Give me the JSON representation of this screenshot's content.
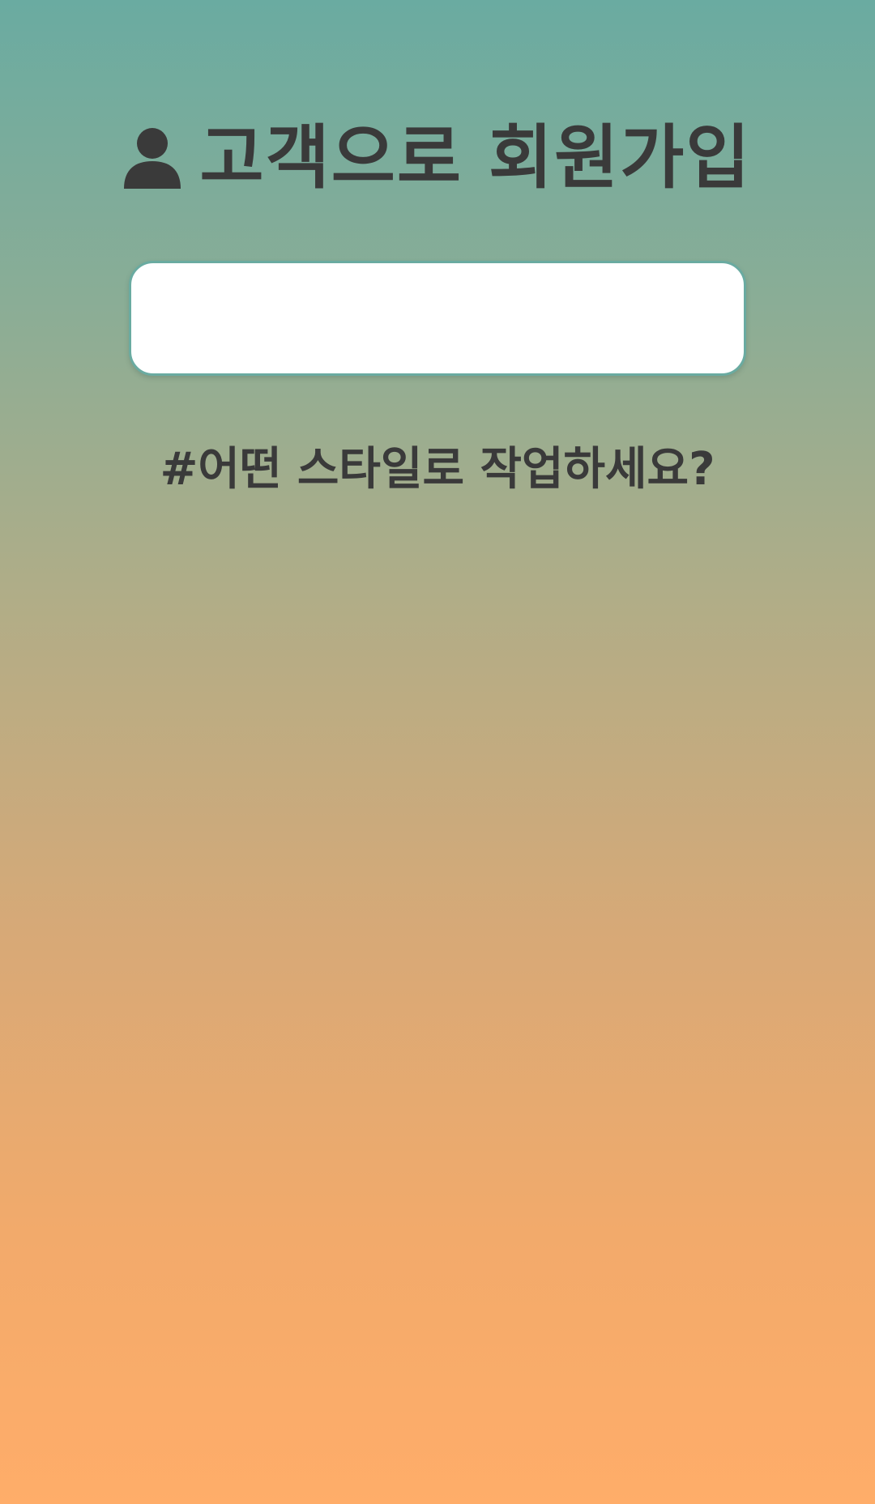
{
  "header": {
    "icon": "user-icon",
    "title": "고객으로 회원가입"
  },
  "form": {
    "input_value": "",
    "input_placeholder": ""
  },
  "prompt": {
    "question": "#어떤 스타일로 작업하세요?"
  },
  "colors": {
    "text": "#3a3a3a",
    "input_border": "#6aaba1",
    "gradient_top": "#6aaba1",
    "gradient_bottom": "#ffad69"
  }
}
